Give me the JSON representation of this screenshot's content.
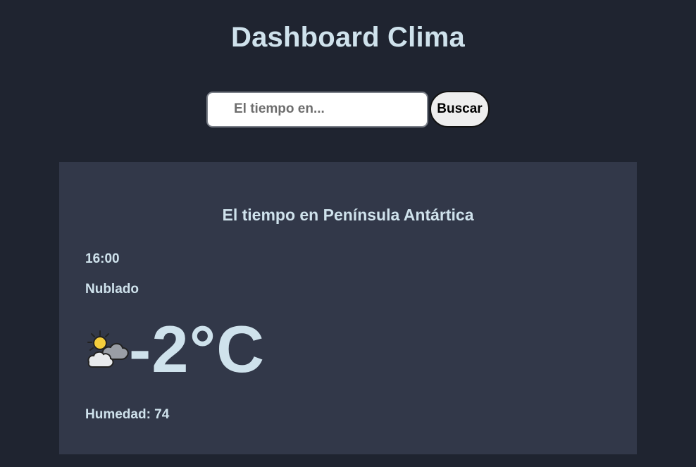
{
  "header": {
    "title": "Dashboard Clima"
  },
  "search": {
    "placeholder": "El tiempo en...",
    "value": "",
    "button_label": "Buscar"
  },
  "weather": {
    "heading": "El tiempo en Península Antártica",
    "time": "16:00",
    "condition": "Nublado",
    "icon": "partly-cloudy-icon",
    "temperature": "-2°C",
    "humidity": "Humedad: 74"
  },
  "colors": {
    "background": "#1f2430",
    "card": "#323849",
    "text": "#cfe2ec"
  }
}
